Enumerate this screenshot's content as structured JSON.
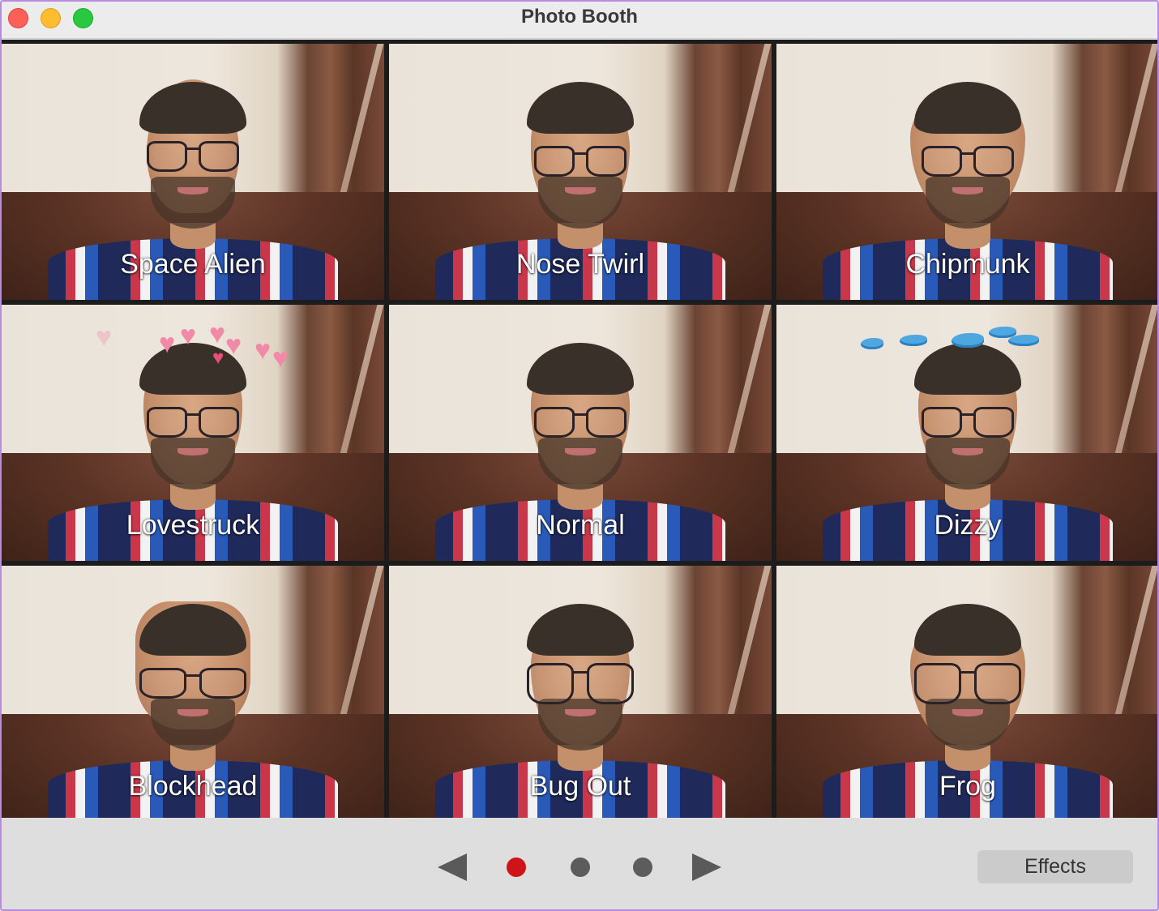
{
  "window": {
    "title": "Photo Booth",
    "controls": [
      {
        "name": "close",
        "color": "#fe5f57"
      },
      {
        "name": "minimize",
        "color": "#febc2e"
      },
      {
        "name": "zoom",
        "color": "#28c840"
      }
    ]
  },
  "effects_grid": {
    "cells": [
      {
        "label": "Space Alien",
        "overlay": "none"
      },
      {
        "label": "Nose Twirl",
        "overlay": "none"
      },
      {
        "label": "Chipmunk",
        "overlay": "none"
      },
      {
        "label": "Lovestruck",
        "overlay": "hearts"
      },
      {
        "label": "Normal",
        "overlay": "none"
      },
      {
        "label": "Dizzy",
        "overlay": "birds"
      },
      {
        "label": "Blockhead",
        "overlay": "none"
      },
      {
        "label": "Bug Out",
        "overlay": "none"
      },
      {
        "label": "Frog",
        "overlay": "none"
      }
    ]
  },
  "pager": {
    "prev_icon": "triangle-left-icon",
    "next_icon": "triangle-right-icon",
    "pages": 3,
    "current_page": 1,
    "active_color": "#cf1419",
    "inactive_color": "#5c5c5c"
  },
  "toolbar": {
    "effects_label": "Effects"
  }
}
